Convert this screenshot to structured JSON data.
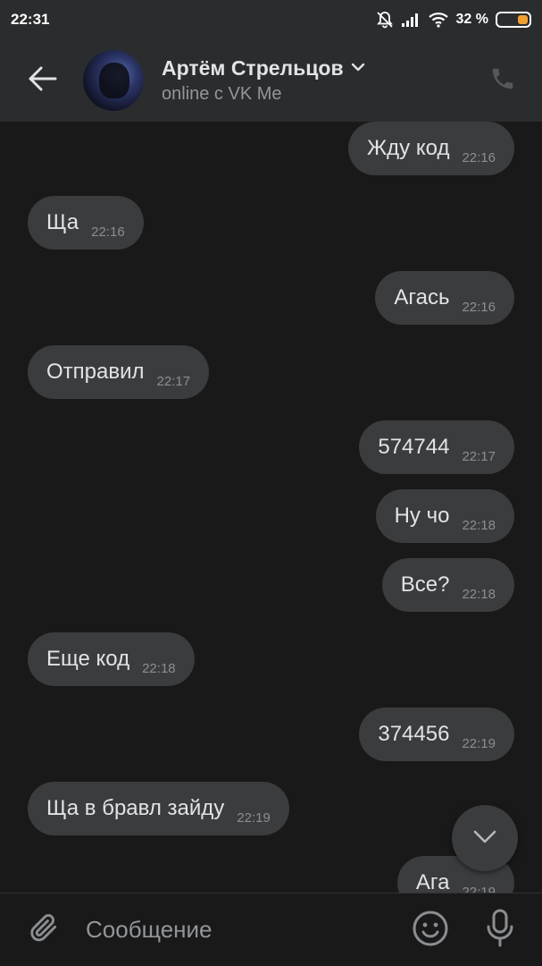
{
  "status_bar": {
    "time": "22:31",
    "battery_percent": "32 %",
    "battery_level": 0.32
  },
  "header": {
    "contact_name": "Артём Стрельцов",
    "contact_status": "online с VK Me",
    "icons": [
      "back-arrow-icon",
      "chevron-down-icon",
      "phone-icon"
    ]
  },
  "messages": [
    {
      "direction": "out",
      "text": "Жду код",
      "time": "22:16"
    },
    {
      "direction": "in",
      "text": "Ща",
      "time": "22:16"
    },
    {
      "direction": "out",
      "text": "Агась",
      "time": "22:16"
    },
    {
      "direction": "in",
      "text": "Отправил",
      "time": "22:17"
    },
    {
      "direction": "out",
      "text": "574744",
      "time": "22:17"
    },
    {
      "direction": "out",
      "text": "Ну чо",
      "time": "22:18"
    },
    {
      "direction": "out",
      "text": "Все?",
      "time": "22:18"
    },
    {
      "direction": "in",
      "text": "Еще код",
      "time": "22:18"
    },
    {
      "direction": "out",
      "text": "374456",
      "time": "22:19"
    },
    {
      "direction": "in",
      "text": "Ща в бравл зайду",
      "time": "22:19"
    },
    {
      "direction": "out",
      "text": "Ага",
      "time": "22:19"
    }
  ],
  "input": {
    "placeholder": "Сообщение",
    "icons": [
      "paperclip-icon",
      "emoji-icon",
      "microphone-icon"
    ]
  },
  "colors": {
    "background": "#19191a",
    "header": "#2b2c2e",
    "bubble": "#3b3c3e",
    "text": "#e1e3e6",
    "secondary_text": "#939699",
    "battery_accent": "#f0a030"
  }
}
